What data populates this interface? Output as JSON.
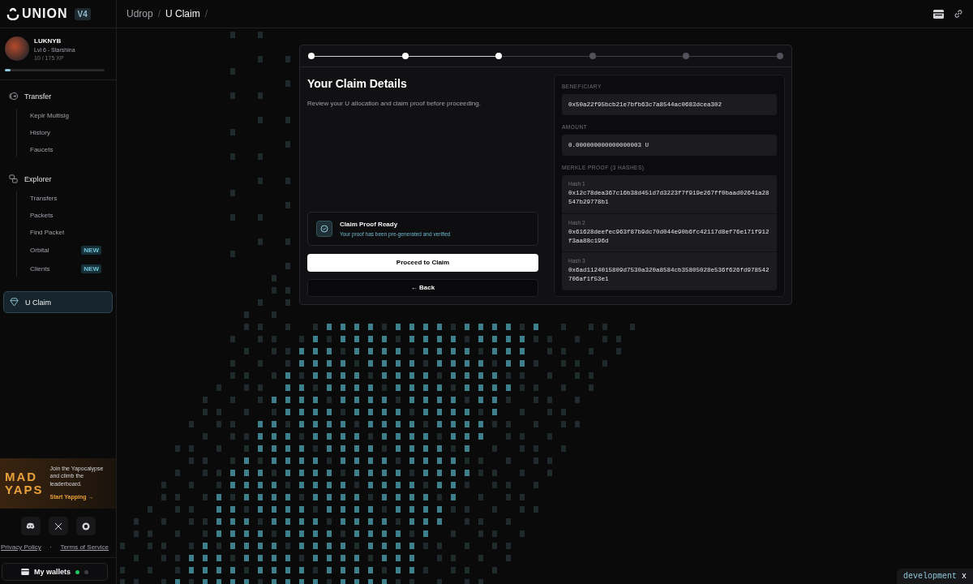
{
  "header": {
    "logo": "UNION",
    "version": "V4",
    "breadcrumb": [
      "Udrop",
      "/",
      "U Claim",
      "/"
    ]
  },
  "sidebar": {
    "profile": {
      "name": "LUKNYB",
      "level_label": "Lvl 6 - Starshina",
      "xp": "10 / 175 XP",
      "level": 0.06
    },
    "nav": [
      {
        "kind": "group",
        "label": "Transfer",
        "children": [
          {
            "label": "Keplr Multisig",
            "selected": false
          },
          {
            "label": "History",
            "selected": false
          },
          {
            "label": "Faucets",
            "selected": false
          }
        ]
      },
      {
        "kind": "group",
        "label": "Explorer",
        "children": [
          {
            "label": "Transfers",
            "selected": false
          },
          {
            "label": "Packets",
            "selected": false
          },
          {
            "label": "Find Packet",
            "selected": false
          },
          {
            "label": "Orbital",
            "badge": "NEW",
            "selected": false
          },
          {
            "label": "Clients",
            "badge": "NEW",
            "selected": false
          }
        ]
      },
      {
        "kind": "link",
        "label": "U Claim",
        "selected": true
      }
    ],
    "promo": {
      "logo": [
        "MAD",
        "YAPS"
      ],
      "text": "Join the Yapocalypse and climb the leaderboard.",
      "link": "Start Yapping →"
    },
    "footer_links": [
      "Privacy Policy",
      "·",
      "Terms of Service"
    ],
    "wallet": {
      "label": "My wallets",
      "dots": [
        {
          "color": "#22c55e"
        },
        {
          "color": "#3f3f46"
        }
      ]
    }
  },
  "claim": {
    "steps": [
      {
        "done": true
      },
      {
        "done": true
      },
      {
        "done": true
      },
      {
        "done": false
      },
      {
        "done": false
      },
      {
        "done": false
      }
    ],
    "title": "Your Claim Details",
    "subtitle": "Review your U allocation and claim proof before proceeding.",
    "status": {
      "title": "Claim Proof Ready",
      "text": "Your proof has been pre-generated and verified"
    },
    "primary_button": "Proceed to Claim",
    "back_button": "← Back",
    "fields": [
      {
        "label": "BENEFICIARY",
        "value": "0x50a22f95bcb21e7bfb63c7a8544ac0683dcea302"
      },
      {
        "label": "AMOUNT",
        "value": "0.000000000000000003 U"
      }
    ],
    "proof": {
      "label": "MERKLE PROOF (3 HASHES)",
      "hashes": [
        {
          "label": "Hash 1",
          "value": "0x12c78dea367c16b38d451d7d3223f7f919e267ff0baad02641a28547b29778b1"
        },
        {
          "label": "Hash 2",
          "value": "0x61628deefec963f87b9dc70d044e90b6fc42117d8ef76e171f912f3aa88c196d"
        },
        {
          "label": "Hash 3",
          "value": "0x6ad1124015809d7530a320a8584cb35805028e536f626fd978542706af1f53e1"
        }
      ]
    }
  },
  "env_badge": {
    "label": "development",
    "close": "x"
  }
}
